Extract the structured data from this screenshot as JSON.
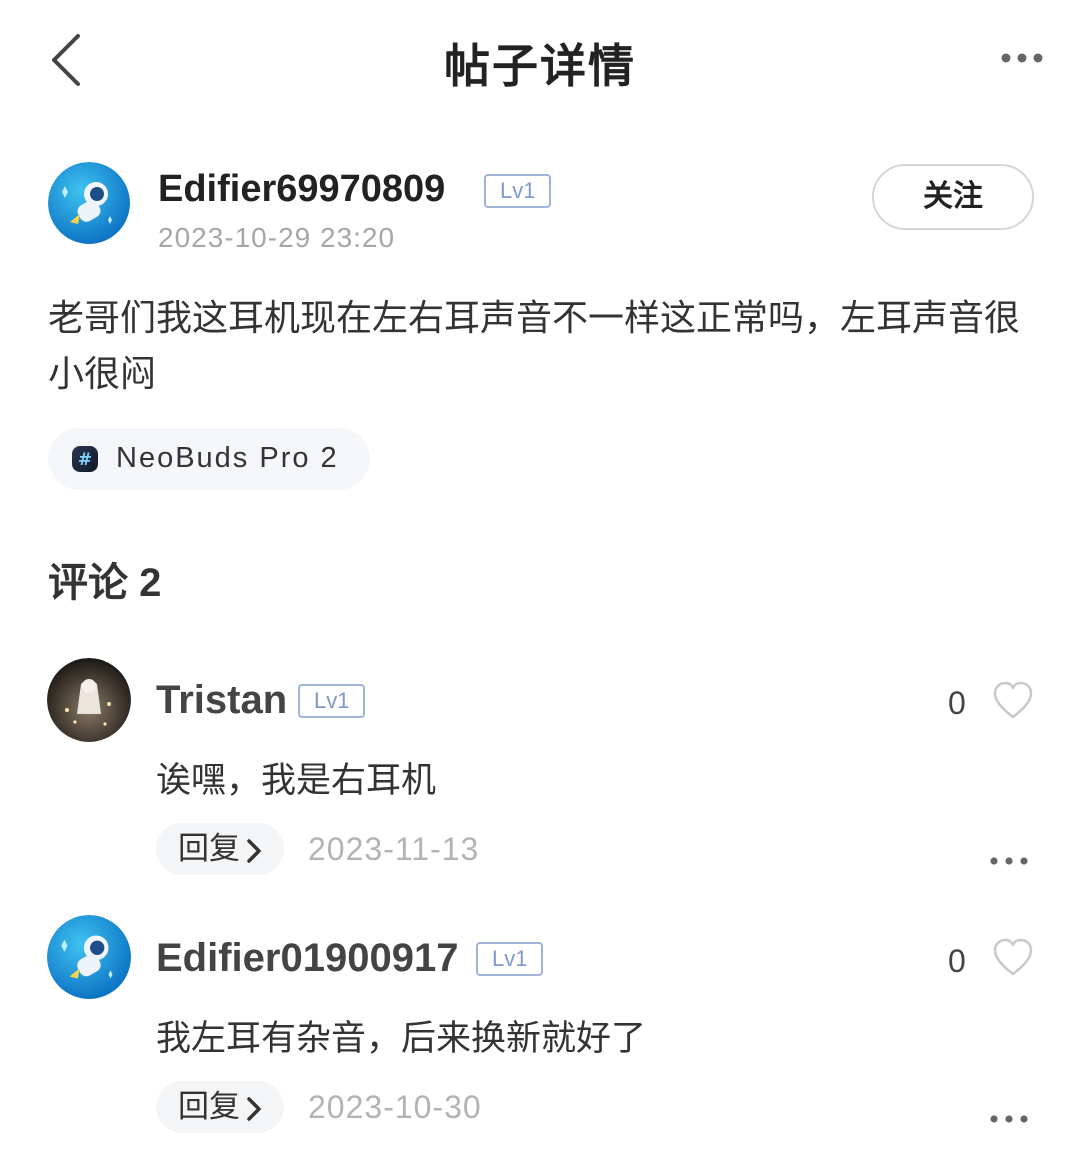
{
  "header": {
    "title": "帖子详情",
    "back_icon": "chevron-left-icon",
    "more_icon": "more-horizontal-icon"
  },
  "post": {
    "author": {
      "name": "Edifier69970809",
      "level": "Lv1",
      "avatar_icon": "astronaut-avatar"
    },
    "time": "2023-10-29 23:20",
    "follow_label": "关注",
    "content": "老哥们我这耳机现在左右耳声音不一样这正常吗，左耳声音很小很闷",
    "tag": {
      "icon": "hashtag-icon",
      "label": "NeoBuds Pro 2"
    }
  },
  "comments_section": {
    "title": "评论 2",
    "items": [
      {
        "name": "Tristan",
        "level": "Lv1",
        "avatar_icon": "anime-photo-avatar",
        "likes": "0",
        "text": "诶嘿，我是右耳机",
        "reply_label": "回复",
        "date": "2023-11-13"
      },
      {
        "name": "Edifier01900917",
        "level": "Lv1",
        "avatar_icon": "astronaut-avatar",
        "likes": "0",
        "text": "我左耳有杂音，后来换新就好了",
        "reply_label": "回复",
        "date": "2023-10-30"
      }
    ]
  },
  "colors": {
    "level_badge": "#7f99cc",
    "muted_text": "#a6a6a6",
    "avatar_blue": "#1b8fd8"
  }
}
